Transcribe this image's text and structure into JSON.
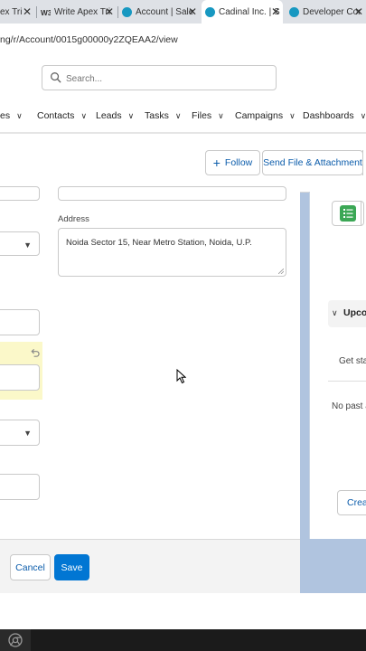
{
  "browser": {
    "tabs": [
      {
        "label": "ex Tri",
        "icon": "salesforce-cloud-icon"
      },
      {
        "label": "Write Apex Tri",
        "icon": "w3-logo-icon"
      },
      {
        "label": "Account | Sale",
        "icon": "salesforce-cloud-icon"
      },
      {
        "label": "Cadinal Inc. | S",
        "icon": "salesforce-cloud-icon",
        "active": true
      },
      {
        "label": "Developer Cor",
        "icon": "salesforce-cloud-icon"
      }
    ],
    "url": "ng/r/Account/0015g00000y2ZQEAA2/view"
  },
  "header": {
    "search_placeholder": "Search..."
  },
  "nav": {
    "items": [
      "es",
      "Contacts",
      "Leads",
      "Tasks",
      "Files",
      "Campaigns",
      "Dashboards"
    ]
  },
  "actions": {
    "follow_label": "Follow",
    "send_file_label": "Send File & Attachment"
  },
  "form": {
    "address_label": "Address",
    "address_value": "Noida Sector 15, Near Metro Station, Noida, U.P."
  },
  "footer": {
    "cancel_label": "Cancel",
    "save_label": "Save"
  },
  "right_panel": {
    "upcoming_label": "Upco",
    "get_started_text": "Get star",
    "no_past_text": "No past ac",
    "create_label": "Creat"
  },
  "colors": {
    "brand_blue": "#0176d3",
    "link_blue": "#0b5cab",
    "highlight_yellow": "#fbf8c9",
    "page_background": "#b0c4df",
    "task_green": "#3ba755"
  }
}
